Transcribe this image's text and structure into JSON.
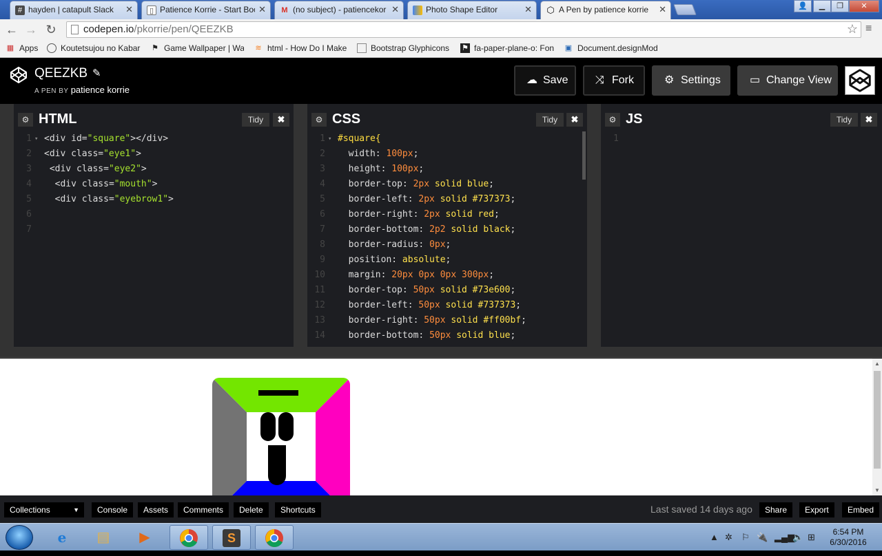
{
  "browser": {
    "tabs": [
      {
        "title": "hayden | catapult Slack",
        "icon": "slack-hash-icon"
      },
      {
        "title": "Patience Korrie - Start Boo",
        "icon": "document-icon"
      },
      {
        "title": "(no subject) - patiencekor",
        "icon": "gmail-icon"
      },
      {
        "title": "Photo Shape Editor",
        "icon": "editor-icon"
      },
      {
        "title": "A Pen by patience korrie",
        "icon": "codepen-icon"
      }
    ],
    "url_host": "codepen.io",
    "url_path": "/pkorrie/pen/QEEZKB",
    "bookmarks": [
      {
        "label": "Apps",
        "icon": "apps-grid-icon"
      },
      {
        "label": "Koutetsujou no Kabar",
        "icon": "site-icon"
      },
      {
        "label": "Game Wallpaper | Wa",
        "icon": "flag-icon"
      },
      {
        "label": "html - How Do I Make",
        "icon": "stackoverflow-icon"
      },
      {
        "label": "Bootstrap Glyphicons",
        "icon": "page-icon"
      },
      {
        "label": "fa-paper-plane-o: Fon",
        "icon": "fontawesome-icon"
      },
      {
        "label": "Document.designMod",
        "icon": "mdn-icon"
      }
    ]
  },
  "codepen": {
    "pen_title": "QEEZKB",
    "by_prefix": "A PEN BY",
    "author": "patience korrie",
    "buttons": {
      "save": "Save",
      "fork": "Fork",
      "settings": "Settings",
      "change_view": "Change View"
    }
  },
  "panes": {
    "html": {
      "label": "HTML",
      "tidy": "Tidy"
    },
    "css": {
      "label": "CSS",
      "tidy": "Tidy"
    },
    "js": {
      "label": "JS",
      "tidy": "Tidy"
    }
  },
  "html_code": [
    [
      {
        "t": "<div ",
        "c": "t-tag"
      },
      {
        "t": "id",
        "c": "t-attr"
      },
      {
        "t": "=",
        "c": "t-tag"
      },
      {
        "t": "\"square\"",
        "c": "t-str"
      },
      {
        "t": "></div>",
        "c": "t-tag"
      }
    ],
    [
      {
        "t": "<div ",
        "c": "t-tag"
      },
      {
        "t": "class",
        "c": "t-attr"
      },
      {
        "t": "=",
        "c": "t-tag"
      },
      {
        "t": "\"eye1\"",
        "c": "t-str"
      },
      {
        "t": ">",
        "c": "t-tag"
      }
    ],
    [
      {
        "t": " <div ",
        "c": "t-tag"
      },
      {
        "t": "class",
        "c": "t-attr"
      },
      {
        "t": "=",
        "c": "t-tag"
      },
      {
        "t": "\"eye2\"",
        "c": "t-str"
      },
      {
        "t": ">",
        "c": "t-tag"
      }
    ],
    [
      {
        "t": "  <div ",
        "c": "t-tag"
      },
      {
        "t": "class",
        "c": "t-attr"
      },
      {
        "t": "=",
        "c": "t-tag"
      },
      {
        "t": "\"mouth\"",
        "c": "t-str"
      },
      {
        "t": ">",
        "c": "t-tag"
      }
    ],
    [
      {
        "t": "  <div ",
        "c": "t-tag"
      },
      {
        "t": "class",
        "c": "t-attr"
      },
      {
        "t": "=",
        "c": "t-tag"
      },
      {
        "t": "\"eyebrow1\"",
        "c": "t-str"
      },
      {
        "t": ">",
        "c": "t-tag"
      }
    ],
    [],
    []
  ],
  "css_code": [
    [
      {
        "t": "#square{",
        "c": "t-sel"
      }
    ],
    [
      {
        "t": "  width: ",
        "c": "t-prop"
      },
      {
        "t": "100px",
        "c": "t-num"
      },
      {
        "t": ";",
        "c": "t-prop"
      }
    ],
    [
      {
        "t": "  height: ",
        "c": "t-prop"
      },
      {
        "t": "100px",
        "c": "t-num"
      },
      {
        "t": ";",
        "c": "t-prop"
      }
    ],
    [
      {
        "t": "  border-top: ",
        "c": "t-prop"
      },
      {
        "t": "2px",
        "c": "t-num"
      },
      {
        "t": " solid blue",
        "c": "t-val"
      },
      {
        "t": ";",
        "c": "t-prop"
      }
    ],
    [
      {
        "t": "  border-left: ",
        "c": "t-prop"
      },
      {
        "t": "2px",
        "c": "t-num"
      },
      {
        "t": " solid #737373",
        "c": "t-val"
      },
      {
        "t": ";",
        "c": "t-prop"
      }
    ],
    [
      {
        "t": "  border-right: ",
        "c": "t-prop"
      },
      {
        "t": "2px",
        "c": "t-num"
      },
      {
        "t": " solid red",
        "c": "t-val"
      },
      {
        "t": ";",
        "c": "t-prop"
      }
    ],
    [
      {
        "t": "  border-bottom: ",
        "c": "t-prop"
      },
      {
        "t": "2p2",
        "c": "t-num"
      },
      {
        "t": " solid black",
        "c": "t-val"
      },
      {
        "t": ";",
        "c": "t-prop"
      }
    ],
    [
      {
        "t": "  border-radius: ",
        "c": "t-prop"
      },
      {
        "t": "0px",
        "c": "t-num"
      },
      {
        "t": ";",
        "c": "t-prop"
      }
    ],
    [
      {
        "t": "  position: ",
        "c": "t-prop"
      },
      {
        "t": "absolute",
        "c": "t-val"
      },
      {
        "t": ";",
        "c": "t-prop"
      }
    ],
    [
      {
        "t": "  margin: ",
        "c": "t-prop"
      },
      {
        "t": "20px",
        "c": "t-num"
      },
      {
        "t": " ",
        "c": "t-prop"
      },
      {
        "t": "0px",
        "c": "t-num"
      },
      {
        "t": " ",
        "c": "t-prop"
      },
      {
        "t": "0px",
        "c": "t-num"
      },
      {
        "t": " ",
        "c": "t-prop"
      },
      {
        "t": "300px",
        "c": "t-num"
      },
      {
        "t": ";",
        "c": "t-prop"
      }
    ],
    [
      {
        "t": "  border-top: ",
        "c": "t-prop"
      },
      {
        "t": "50px",
        "c": "t-num"
      },
      {
        "t": " solid #73e600",
        "c": "t-val"
      },
      {
        "t": ";",
        "c": "t-prop"
      }
    ],
    [
      {
        "t": "  border-left: ",
        "c": "t-prop"
      },
      {
        "t": "50px",
        "c": "t-num"
      },
      {
        "t": " solid #737373",
        "c": "t-val"
      },
      {
        "t": ";",
        "c": "t-prop"
      }
    ],
    [
      {
        "t": "  border-right: ",
        "c": "t-prop"
      },
      {
        "t": "50px",
        "c": "t-num"
      },
      {
        "t": " solid #ff00bf",
        "c": "t-val"
      },
      {
        "t": ";",
        "c": "t-prop"
      }
    ],
    [
      {
        "t": "  border-bottom: ",
        "c": "t-prop"
      },
      {
        "t": "50px",
        "c": "t-num"
      },
      {
        "t": " solid blue",
        "c": "t-val"
      },
      {
        "t": ";",
        "c": "t-prop"
      }
    ]
  ],
  "js_code": [
    []
  ],
  "preview_colors": {
    "top": "#73e600",
    "left": "#737373",
    "right": "#ff00bf",
    "bottom": "#0000ff",
    "center": "#ffffff",
    "features": "#000000"
  },
  "footer": {
    "collections": "Collections",
    "console": "Console",
    "assets": "Assets",
    "comments": "Comments",
    "delete": "Delete",
    "shortcuts": "Shortcuts",
    "last_saved": "Last saved 14 days ago",
    "share": "Share",
    "export": "Export",
    "embed": "Embed"
  },
  "taskbar": {
    "apps": [
      "internet-explorer-icon",
      "file-explorer-icon",
      "media-player-icon",
      "chrome-icon",
      "sublime-text-icon",
      "chrome-icon"
    ],
    "time": "6:54 PM",
    "date": "6/30/2016"
  }
}
